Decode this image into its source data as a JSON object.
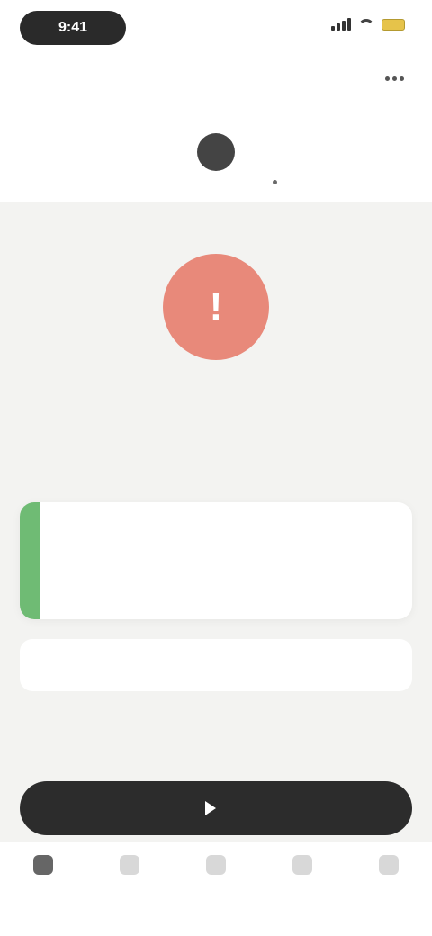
{
  "status_bar": {
    "time": "9:41"
  },
  "header": {
    "back_label": "",
    "title": "",
    "days": [
      {
        "label": "",
        "num": ""
      },
      {
        "label": "",
        "num": ""
      },
      {
        "label": "",
        "num": ""
      },
      {
        "label": "",
        "num": "",
        "selected": true
      },
      {
        "label": "",
        "num": "",
        "dot": true
      },
      {
        "label": "",
        "num": ""
      },
      {
        "label": "",
        "num": ""
      }
    ]
  },
  "main": {
    "alert_icon": "!",
    "alert_title": "",
    "alert_subtitle": "",
    "card": {
      "title": "",
      "detail": "",
      "meta": ""
    },
    "remove_label": ""
  },
  "bottom": {
    "primary_button_label": "",
    "tabs": [
      {
        "label": "",
        "active": true
      },
      {
        "label": ""
      },
      {
        "label": ""
      },
      {
        "label": ""
      },
      {
        "label": ""
      }
    ]
  },
  "colors": {
    "alert": "#e8897a",
    "accent_green": "#6fbb74",
    "danger_text": "#e2574c",
    "primary_button": "#2c2c2c"
  }
}
